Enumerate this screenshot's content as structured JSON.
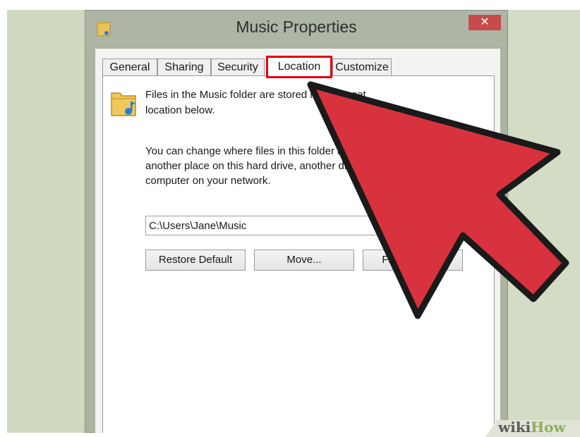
{
  "window": {
    "title": "Music Properties",
    "close_label": "✕"
  },
  "tabs": [
    {
      "label": "General"
    },
    {
      "label": "Sharing"
    },
    {
      "label": "Security"
    },
    {
      "label": "Location",
      "active": true
    },
    {
      "label": "Customize"
    }
  ],
  "location": {
    "description_line1": "Files in the Music folder are stored in the target",
    "description_line2": "location below.",
    "change_line1": "You can change where files in this folder are stored to",
    "change_line2": "another place on this hard drive, another drive, or another",
    "change_line3": "computer on your network.",
    "path_value": "C:\\Users\\Jane\\Music"
  },
  "buttons": {
    "restore_default": "Restore Default",
    "move": "Move...",
    "find_target": "Find Target..."
  },
  "watermark": {
    "part1": "wiki",
    "part2": "How"
  },
  "colors": {
    "highlight_box": "#e0000f",
    "arrow_fill": "#d9323f",
    "arrow_outline": "#1a1a1a",
    "background": "#d3dcc5"
  },
  "icons": [
    "folder-music-icon",
    "close-icon",
    "arrow-pointer-icon"
  ]
}
